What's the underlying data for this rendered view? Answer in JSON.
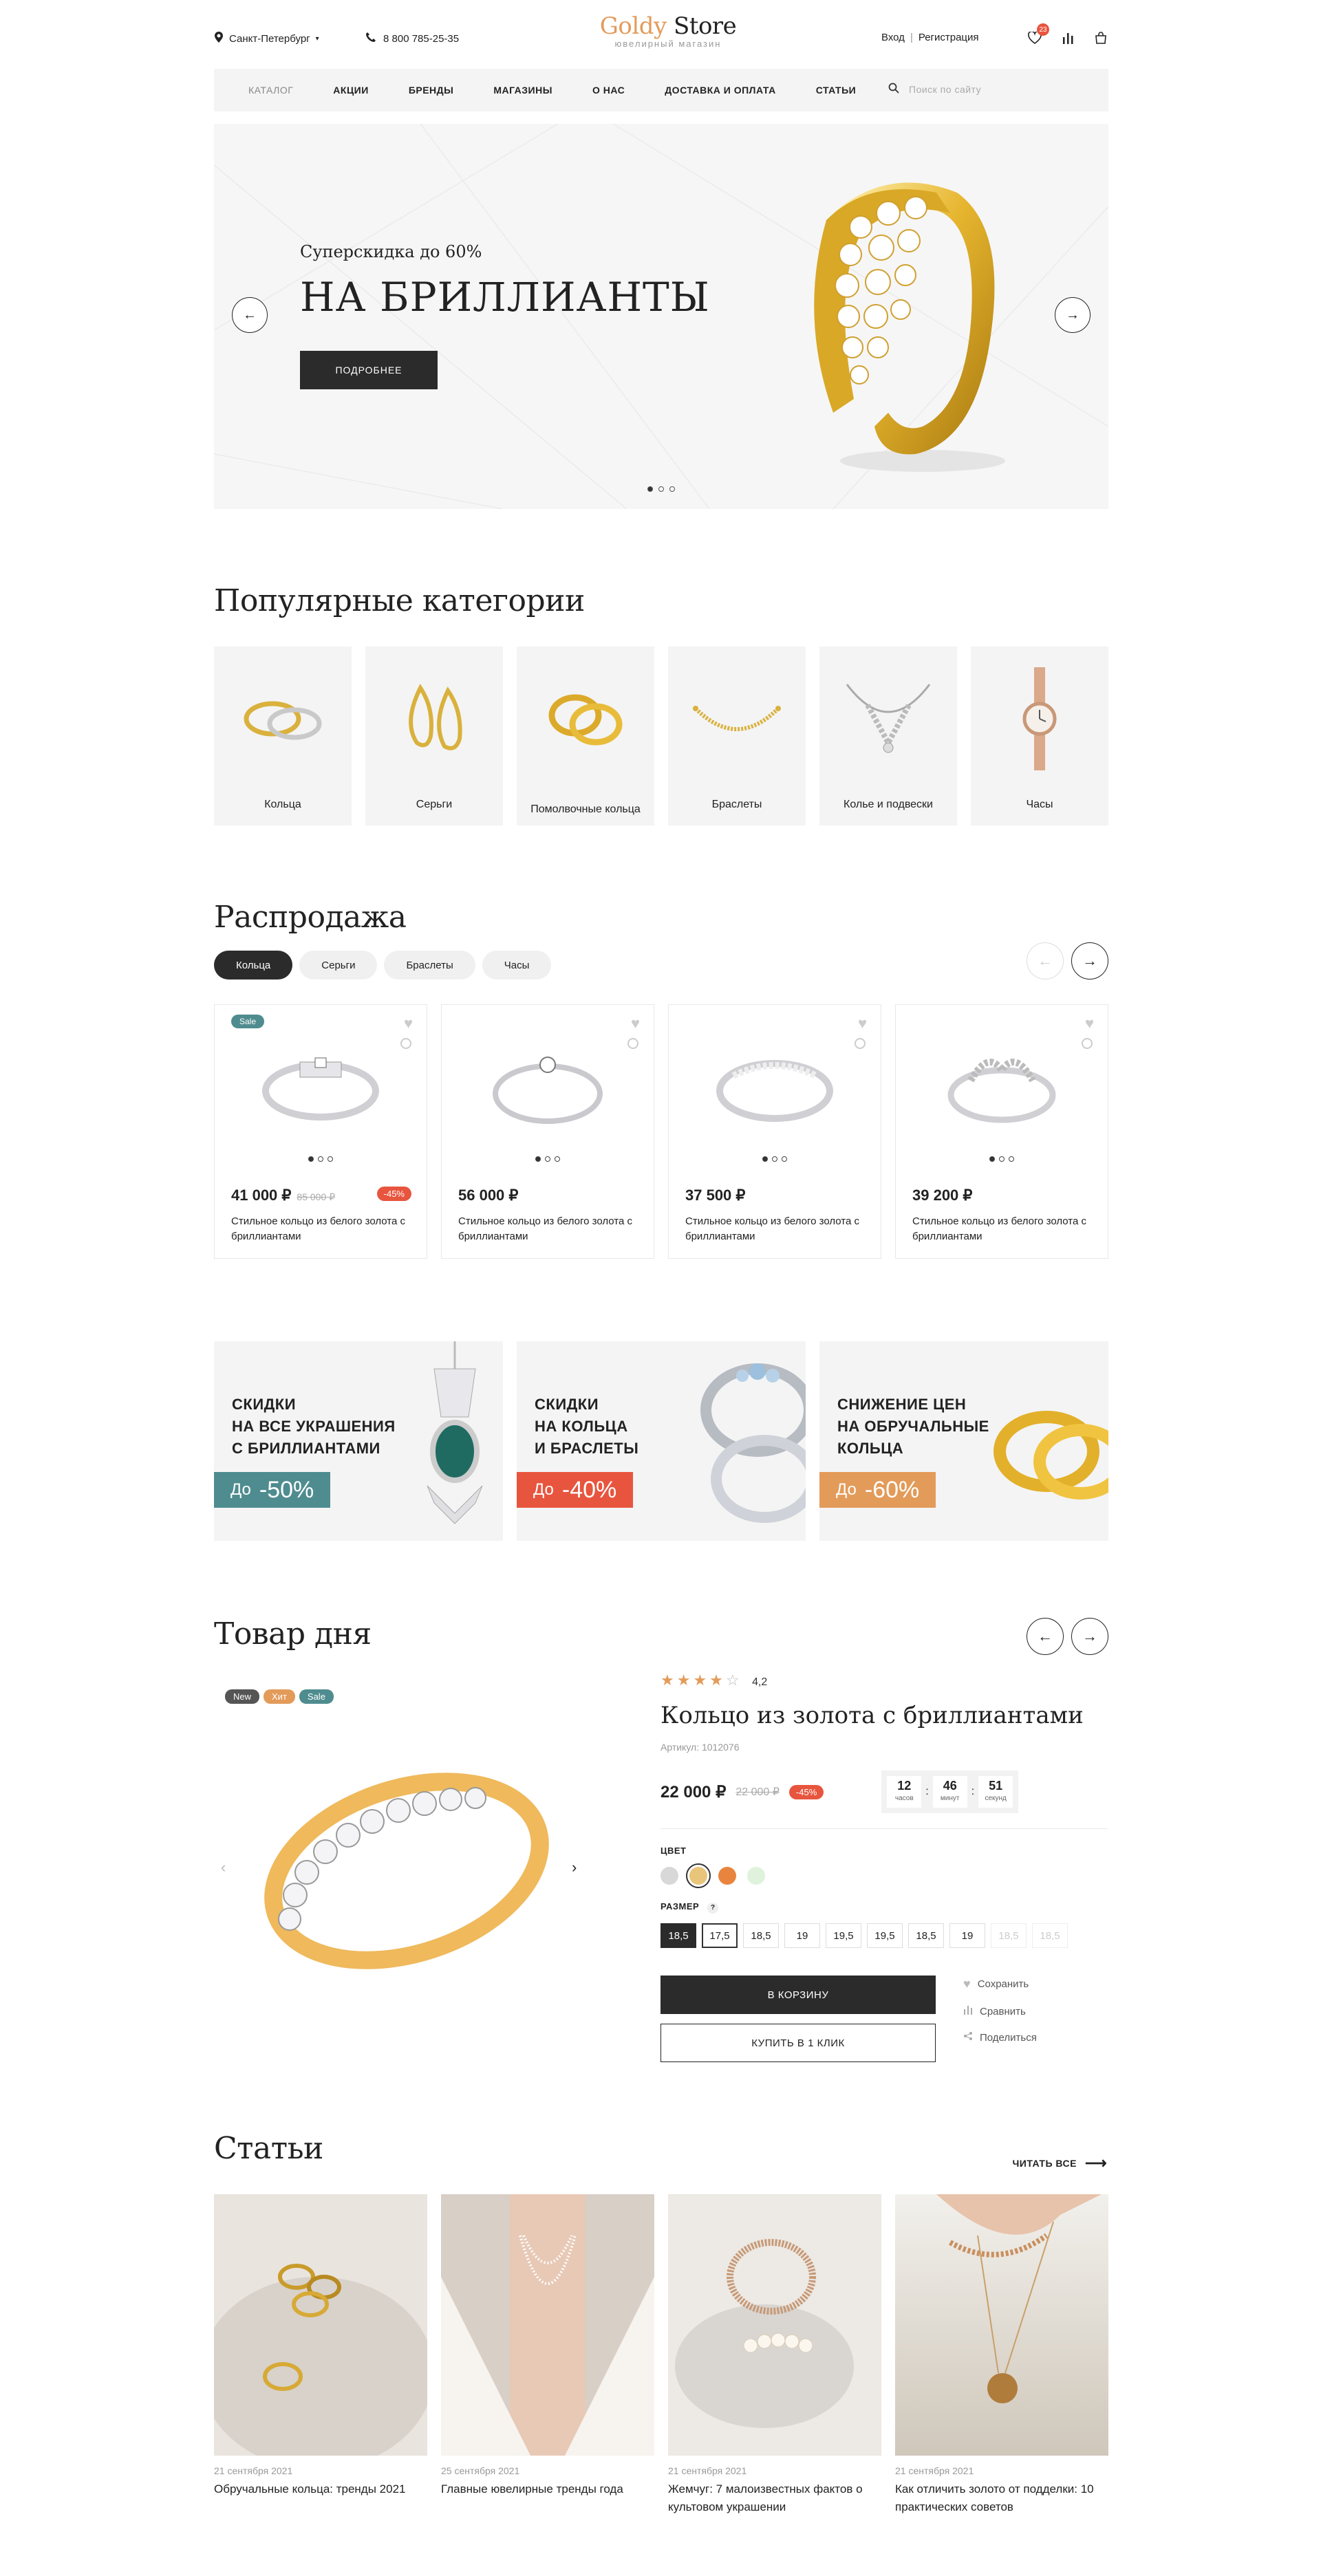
{
  "header": {
    "city": "Санкт-Петербург",
    "phone": "8 800 785-25-35",
    "logo_part1": "Goldy",
    "logo_part2": "Store",
    "logo_sub": "ювелирный магазин",
    "login": "Вход",
    "register": "Регистрация",
    "fav_count": "23"
  },
  "nav": {
    "items": [
      "КАТАЛОГ",
      "АКЦИИ",
      "БРЕНДЫ",
      "МАГАЗИНЫ",
      "О НАС",
      "ДОСТАВКА И ОПЛАТА",
      "СТАТЬИ"
    ],
    "search_placeholder": "Поиск по сайту"
  },
  "hero": {
    "subtitle": "Суперскидка до 60%",
    "title": "НА БРИЛЛИАНТЫ",
    "button": "ПОДРОБНЕЕ",
    "arrow_left": "←",
    "arrow_right": "→"
  },
  "categories": {
    "title": "Популярные категории",
    "items": [
      "Кольца",
      "Серьги",
      "Помолвочные кольца",
      "Браслеты",
      "Колье и подвески",
      "Часы"
    ]
  },
  "sale": {
    "title": "Распродажа",
    "filters": [
      "Кольца",
      "Серьги",
      "Браслеты",
      "Часы"
    ],
    "products": [
      {
        "price": "41 000 ₽",
        "old": "85 000 ₽",
        "disc": "-45%",
        "badge": "Sale",
        "desc": "Стильное кольцо из белого золота с бриллиантами"
      },
      {
        "price": "56 000 ₽",
        "desc": "Стильное кольцо из белого золота с бриллиантами"
      },
      {
        "price": "37 500 ₽",
        "desc": "Стильное кольцо из белого золота с бриллиантами"
      },
      {
        "price": "39 200 ₽",
        "desc": "Стильное кольцо из белого золота с бриллиантами"
      }
    ]
  },
  "promos": [
    {
      "text": "СКИДКИ\nНА ВСЕ УКРАШЕНИЯ\nС БРИЛЛИАНТАМИ",
      "prefix": "До",
      "value": "-50%",
      "color": "#4f8c8f"
    },
    {
      "text": "СКИДКИ\nНА КОЛЬЦА\nИ БРАСЛЕТЫ",
      "prefix": "До",
      "value": "-40%",
      "color": "#e8553e"
    },
    {
      "text": "СНИЖЕНИЕ ЦЕН\nНА ОБРУЧАЛЬНЫЕ\nКОЛЬЦА",
      "prefix": "До",
      "value": "-60%",
      "color": "#e39b5a"
    }
  ],
  "product_of_day": {
    "title": "Товар дня",
    "tags": [
      "New",
      "Хит",
      "Sale"
    ],
    "rating": "4,2",
    "stars": 4,
    "name": "Кольцо из золота с бриллиантами",
    "sku": "Артикул: 1012076",
    "price": "22 000 ₽",
    "old": "22 000 ₽",
    "disc": "-45%",
    "timer": [
      {
        "v": "12",
        "u": "часов"
      },
      {
        "v": "46",
        "u": "минут"
      },
      {
        "v": "51",
        "u": "секунд"
      }
    ],
    "color_label": "ЦВЕТ",
    "size_label": "РАЗМЕР",
    "sizes": [
      "18,5",
      "17,5",
      "18,5",
      "19",
      "19,5",
      "19,5",
      "18,5",
      "19",
      "18,5",
      "18,5"
    ],
    "cart": "В КОРЗИНУ",
    "buy_one": "КУПИТЬ В 1 КЛИК",
    "save": "Сохранить",
    "compare": "Сравнить",
    "share": "Поделиться",
    "colors": [
      "#d8d8d8",
      "#e8c57a",
      "#e8843e",
      "#dff3dc"
    ]
  },
  "articles": {
    "title": "Статьи",
    "read_all": "ЧИТАТЬ ВСЕ",
    "items": [
      {
        "date": "21 сентября 2021",
        "title": "Обручальные кольца: тренды 2021"
      },
      {
        "date": "25 сентября 2021",
        "title": "Главные ювелирные тренды года"
      },
      {
        "date": "21 сентября 2021",
        "title": "Жемчуг: 7 малоизвестных фактов о культовом украшении"
      },
      {
        "date": "21 сентября 2021",
        "title": "Как отличить золото от подделки: 10 практических советов"
      }
    ]
  }
}
